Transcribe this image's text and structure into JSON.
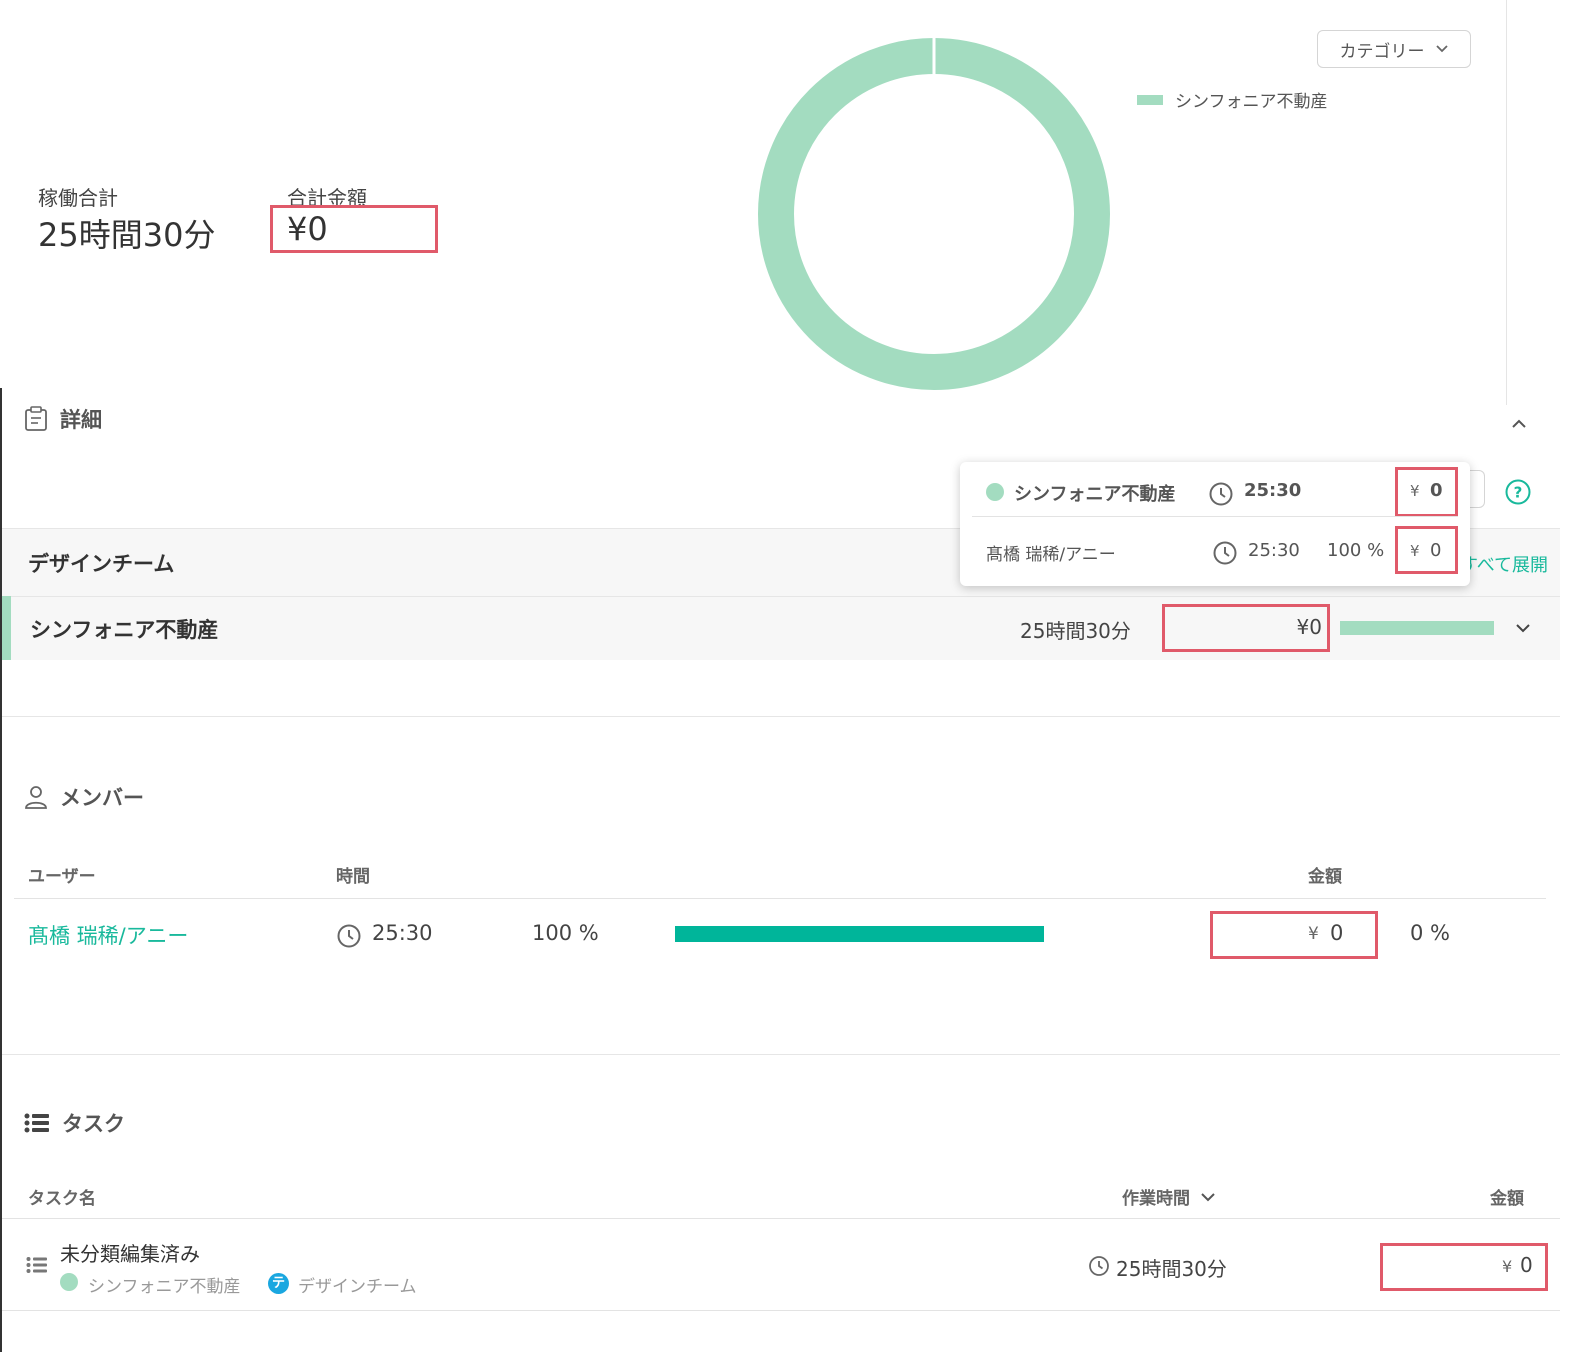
{
  "colors": {
    "accent": "#19b99c",
    "donut": "#a3dcc0",
    "highlight": "#e05a6a",
    "bar": "#00b59a"
  },
  "summary": {
    "total_hours_label": "稼働合計",
    "total_hours_value": "25時間30分",
    "total_amount_label": "合計金額",
    "total_amount_value": "¥0"
  },
  "chart": {
    "category_button": "カテゴリー",
    "legend_label": "シンフォニア不動産"
  },
  "chart_data": {
    "type": "pie",
    "categories": [
      "シンフォニア不動産"
    ],
    "values": [
      100
    ]
  },
  "details": {
    "title": "詳細",
    "expand_all": "すべて展開",
    "team_name": "デザインチーム",
    "client_name": "シンフォニア不動産",
    "client_time": "25時間30分",
    "client_amount": "¥0"
  },
  "tooltip": {
    "client_name": "シンフォニア不動産",
    "client_time": "25:30",
    "client_currency": "¥",
    "client_amount": "0",
    "member_name": "髙橋 瑞稀/アニー",
    "member_time": "25:30",
    "member_pct": "100 %",
    "member_currency": "¥",
    "member_amount": "0"
  },
  "members": {
    "title": "メンバー",
    "col_user": "ユーザー",
    "col_time": "時間",
    "col_amount": "金額",
    "rows": [
      {
        "name": "髙橋 瑞稀/アニー",
        "time": "25:30",
        "pct": "100 %",
        "currency": "¥",
        "amount": "0",
        "amount_pct": "0 %",
        "bar_fraction": 1.0
      }
    ]
  },
  "tasks": {
    "title": "タスク",
    "col_name": "タスク名",
    "col_time": "作業時間",
    "col_amount": "金額",
    "rows": [
      {
        "name": "未分類編集済み",
        "client": "シンフォニア不動産",
        "team_icon": "テ",
        "team": "デザインチーム",
        "time": "25時間30分",
        "currency": "¥",
        "amount": "0"
      }
    ]
  }
}
